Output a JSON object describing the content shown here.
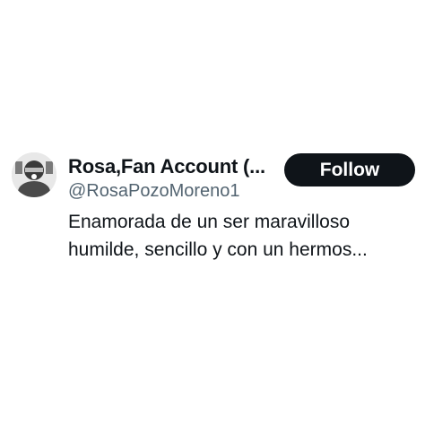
{
  "profile": {
    "name": "Rosa,Fan Account (...",
    "handle": "@RosaPozoMoreno1",
    "bio_lines": [
      "Enamorada de un ser maravilloso",
      "humilde, sencillo y con un hermos..."
    ],
    "avatar_icon": "user-avatar-photo"
  },
  "actions": {
    "follow_label": "Follow"
  },
  "colors": {
    "text_primary": "#0f1419",
    "text_secondary": "#536471",
    "button_bg": "#0f1419",
    "button_text": "#ffffff"
  }
}
